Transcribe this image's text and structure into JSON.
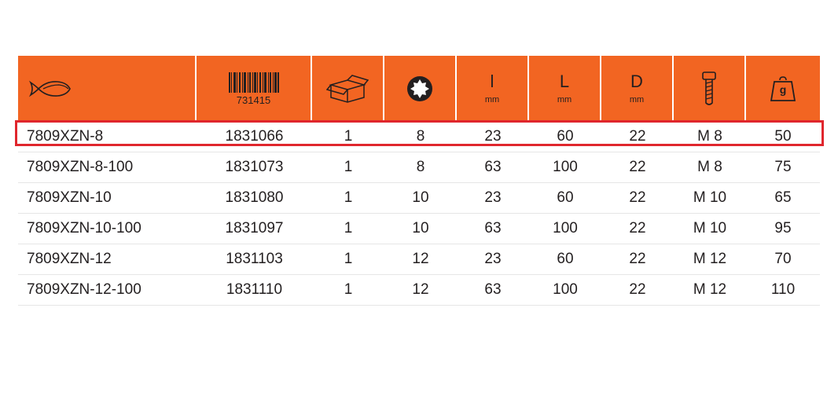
{
  "header": {
    "icons": [
      "fish-icon",
      "barcode-icon",
      "box-icon",
      "socket-12point-icon",
      "l-length-icon",
      "L-length-icon",
      "D-diameter-icon",
      "bolt-icon",
      "weight-icon"
    ],
    "barcode_number": "731415",
    "l_label": "l",
    "l_unit": "mm",
    "L_label": "L",
    "L_unit": "mm",
    "D_label": "D",
    "D_unit": "mm",
    "weight_label": "g"
  },
  "colors": {
    "header_bg": "#f26522",
    "highlight": "#e0262d"
  },
  "rows": [
    {
      "code": "7809XZN-8",
      "ean": "1831066",
      "qty": "1",
      "size": "8",
      "l": "23",
      "L": "60",
      "D": "22",
      "bolt": "M 8",
      "weight": "50"
    },
    {
      "code": "7809XZN-8-100",
      "ean": "1831073",
      "qty": "1",
      "size": "8",
      "l": "63",
      "L": "100",
      "D": "22",
      "bolt": "M 8",
      "weight": "75"
    },
    {
      "code": "7809XZN-10",
      "ean": "1831080",
      "qty": "1",
      "size": "10",
      "l": "23",
      "L": "60",
      "D": "22",
      "bolt": "M 10",
      "weight": "65"
    },
    {
      "code": "7809XZN-10-100",
      "ean": "1831097",
      "qty": "1",
      "size": "10",
      "l": "63",
      "L": "100",
      "D": "22",
      "bolt": "M 10",
      "weight": "95"
    },
    {
      "code": "7809XZN-12",
      "ean": "1831103",
      "qty": "1",
      "size": "12",
      "l": "23",
      "L": "60",
      "D": "22",
      "bolt": "M 12",
      "weight": "70"
    },
    {
      "code": "7809XZN-12-100",
      "ean": "1831110",
      "qty": "1",
      "size": "12",
      "l": "63",
      "L": "100",
      "D": "22",
      "bolt": "M 12",
      "weight": "110"
    }
  ]
}
